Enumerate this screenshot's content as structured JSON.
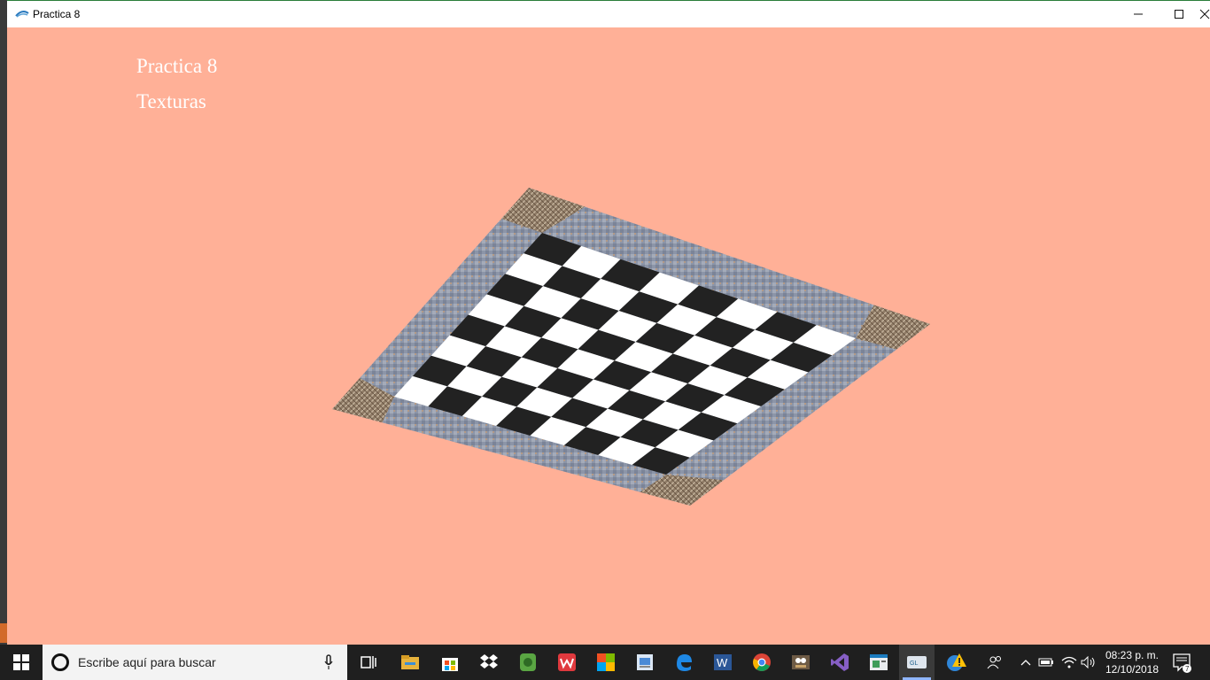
{
  "window": {
    "title": "Practica 8"
  },
  "scene": {
    "line1": "Practica 8",
    "line2": "Texturas",
    "background": "#ffb097",
    "board": {
      "rows": 8,
      "cols": 8,
      "dark": "#222222",
      "light": "#ffffff",
      "frame": "#8a93a6",
      "corner": "#8d7a66"
    }
  },
  "taskbar": {
    "search_placeholder": "Escribe aquí para buscar",
    "time": "08:23 p. m.",
    "date": "12/10/2018",
    "notification_count": "7",
    "apps": [
      "task-view",
      "file-explorer",
      "store",
      "dropbox",
      "evernote",
      "wps-office",
      "office",
      "photos",
      "edge",
      "word",
      "chrome",
      "gimp",
      "visual-studio",
      "app-window",
      "opengl-app",
      "vlc-warning"
    ]
  }
}
